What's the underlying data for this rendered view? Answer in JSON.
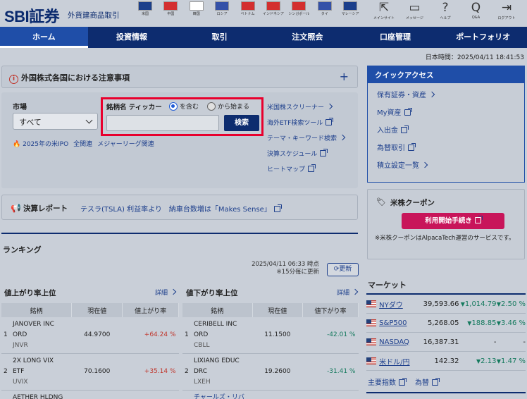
{
  "header": {
    "logo": "SBI証券",
    "subtitle": "外貨建商品取引",
    "flags": [
      {
        "label": "米国",
        "color": "#1b3f8b"
      },
      {
        "label": "中国",
        "color": "#d32f2f"
      },
      {
        "label": "韓国",
        "color": "#ffffff"
      },
      {
        "label": "ロシア",
        "color": "#3451a8"
      },
      {
        "label": "ベトナム",
        "color": "#d32f2f"
      },
      {
        "label": "インドネシア",
        "color": "#d32f2f"
      },
      {
        "label": "シンガポール",
        "color": "#d32f2f"
      },
      {
        "label": "タイ",
        "color": "#3451a8"
      },
      {
        "label": "マレーシア",
        "color": "#1b3f8b"
      }
    ],
    "tools": [
      {
        "label": "メインサイト",
        "icon": "home-arrow-icon",
        "glyph": "⇱"
      },
      {
        "label": "メッセージ",
        "icon": "message-icon",
        "glyph": "▭"
      },
      {
        "label": "ヘルプ",
        "icon": "help-icon",
        "glyph": "?"
      },
      {
        "label": "Q&A",
        "icon": "qa-icon",
        "glyph": "Q"
      },
      {
        "label": "ログアウト",
        "icon": "logout-icon",
        "glyph": "⇥"
      }
    ]
  },
  "nav": [
    "ホーム",
    "投資情報",
    "取引",
    "注文照会",
    "口座管理",
    "ポートフォリオ"
  ],
  "time": "日本時間：2025/04/11 18:41:53",
  "notice": {
    "title": "外国株式各国における注意事項",
    "plus": "+"
  },
  "search": {
    "market_label": "市場",
    "market_value": "すべて",
    "name_label": "銘柄名 ティッカー",
    "radio1": "を含む",
    "radio2": "から始まる",
    "input_value": "",
    "button": "検索",
    "tag_fire": "2025年の米IPO",
    "tag2": "全関連",
    "tag3": "メジャーリーグ関連",
    "links": [
      {
        "label": "米国株スクリーナー",
        "kind": "chev"
      },
      {
        "label": "海外ETF検索ツール",
        "kind": "ext"
      },
      {
        "label": "テーマ・キーワード検索",
        "kind": "chev"
      },
      {
        "label": "決算スケジュール",
        "kind": "ext"
      },
      {
        "label": "ヒートマップ",
        "kind": "ext"
      }
    ]
  },
  "report": {
    "label": "決算レポート",
    "text": "テスラ(TSLA) 利益率より　納車台数増は「Makes Sense」"
  },
  "ranking": {
    "title": "ランキング",
    "updated": "2025/04/11 06:33 時点",
    "interval": "※15分毎に更新",
    "refresh": "更新",
    "gainers": {
      "title": "値上がり率上位",
      "detail": "詳細",
      "headers": [
        "銘柄",
        "現在値",
        "値上がり率"
      ],
      "rows": [
        {
          "rank": "1",
          "name1": "JANOVER INC",
          "name2": "ORD",
          "ticker": "JNVR",
          "price": "44.9700",
          "change": "+64.24 %"
        },
        {
          "rank": "2",
          "name1": "2X LONG VIX",
          "name2": "ETF",
          "ticker": "UVIX",
          "price": "70.1600",
          "change": "+35.14 %"
        },
        {
          "rank": "",
          "name1": "AETHER HLDNG",
          "name2": "",
          "ticker": "",
          "price": "",
          "change": ""
        }
      ]
    },
    "losers": {
      "title": "値下がり率上位",
      "detail": "詳細",
      "headers": [
        "銘柄",
        "現在値",
        "値下がり率"
      ],
      "rows": [
        {
          "rank": "1",
          "name1": "CERIBELL INC",
          "name2": "ORD",
          "ticker": "CBLL",
          "price": "11.1500",
          "change": "-42.01 %"
        },
        {
          "rank": "2",
          "name1": "LIXIANG EDUC",
          "name2": "DRC",
          "ticker": "LXEH",
          "price": "19.2600",
          "change": "-31.41 %"
        },
        {
          "rank": "",
          "name1": "チャールズ・リバ",
          "name2": "",
          "ticker": "",
          "price": "",
          "change": ""
        }
      ]
    }
  },
  "quick": {
    "title": "クイックアクセス",
    "items": [
      {
        "label": "保有証券・資産",
        "kind": "chev"
      },
      {
        "label": "My資産",
        "kind": "ext"
      },
      {
        "label": "入出金",
        "kind": "ext"
      },
      {
        "label": "為替取引",
        "kind": "ext"
      },
      {
        "label": "積立設定一覧",
        "kind": "chev"
      }
    ]
  },
  "coupon": {
    "title": "米株クーポン",
    "button": "利用開始手続き",
    "note": "※米株クーポンはAlpacaTech運営のサービスです。"
  },
  "market": {
    "title": "マーケット",
    "rows": [
      {
        "name": "NYダウ",
        "value": "39,593.66",
        "change": "1,014.79",
        "pct": "2.50 %",
        "dir": "down"
      },
      {
        "name": "S&P500",
        "value": "5,268.05",
        "change": "188.85",
        "pct": "3.46 %",
        "dir": "down"
      },
      {
        "name": "NASDAQ",
        "value": "16,387.31",
        "change": "-",
        "pct": "-",
        "dir": "none"
      },
      {
        "name": "米ドル/円",
        "value": "142.32",
        "change": "2.13",
        "pct": "1.47 %",
        "dir": "down"
      }
    ],
    "links": [
      "主要指数",
      "為替"
    ]
  },
  "colors": {
    "navy": "#0d2c6f",
    "accent_red": "#e8002d",
    "up": "#c0362c",
    "down": "#157a5e"
  }
}
